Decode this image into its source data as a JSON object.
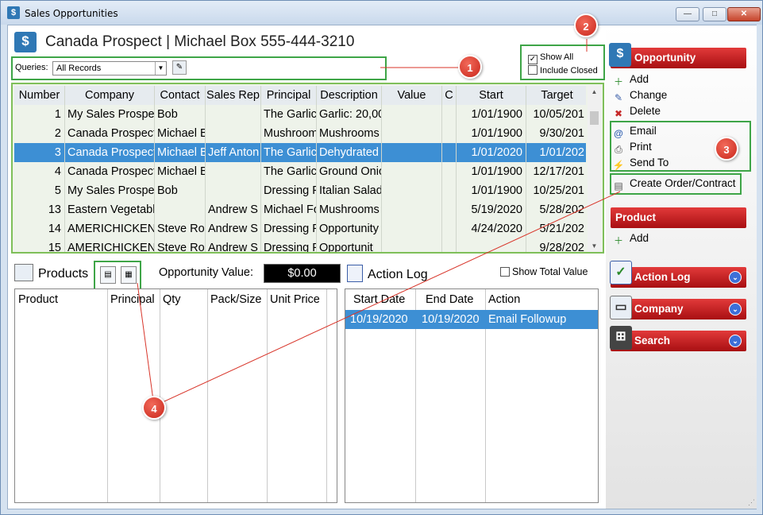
{
  "window": {
    "title": "Sales Opportunities",
    "minimize": "—",
    "maximize": "□",
    "close": "✕"
  },
  "header": {
    "title": "Canada Prospect | Michael Box 555-444-3210"
  },
  "queries": {
    "label": "Queries:",
    "selected": "All Records"
  },
  "filters": {
    "show_all": "Show All",
    "show_all_checked": true,
    "include_closed": "Include Closed",
    "include_closed_checked": false
  },
  "grid": {
    "columns": [
      "Number",
      "Company",
      "Contact",
      "Sales Rep",
      "Principal",
      "Description",
      "Value",
      "C",
      "Start",
      "Target"
    ],
    "rows": [
      [
        "1",
        "My Sales Prospect",
        "Bob",
        "",
        "The Garlic",
        "Garlic: 20,00",
        "",
        "",
        "1/01/1900",
        "10/05/201"
      ],
      [
        "2",
        "Canada Prospect",
        "Michael B",
        "",
        "Mushroom",
        "Mushrooms",
        "",
        "",
        "1/01/1900",
        "9/30/201"
      ],
      [
        "3",
        "Canada Prospect",
        "Michael B",
        "Jeff Anton",
        "The Garlic",
        "Dehydrated",
        "",
        "",
        "1/01/2020",
        "1/01/202"
      ],
      [
        "4",
        "Canada Prospect",
        "Michael B",
        "",
        "The Garlic",
        "Ground Onio",
        "",
        "",
        "1/01/1900",
        "12/17/201"
      ],
      [
        "5",
        "My Sales Prospect",
        "Bob",
        "",
        "Dressing F",
        "Italian Salad",
        "",
        "",
        "1/01/1900",
        "10/25/201"
      ],
      [
        "13",
        "Eastern Vegetable",
        "",
        "Andrew S",
        "Michael Fo",
        "Mushrooms",
        "",
        "",
        "5/19/2020",
        "5/28/202"
      ],
      [
        "14",
        "AMERICHICKEN",
        "Steve Ro",
        "Andrew S",
        "Dressing F",
        "Opportunity",
        "",
        "",
        "4/24/2020",
        "5/21/202"
      ],
      [
        "15",
        "AMERICHICKEN",
        "Steve Ro",
        "Andrew S",
        "Dressing F",
        "Opportunit",
        "",
        "",
        "",
        "9/28/202"
      ]
    ],
    "selected_row": 2
  },
  "products": {
    "label": "Products",
    "columns": [
      "Product",
      "Principal",
      "Qty",
      "Pack/Size",
      "Unit Price"
    ]
  },
  "opportunity_value": {
    "label": "Opportunity Value:",
    "value": "$0.00"
  },
  "action_log": {
    "label": "Action Log",
    "show_total": "Show Total Value",
    "columns": [
      "Start Date",
      "End Date",
      "Action"
    ],
    "rows": [
      [
        "10/19/2020",
        "10/19/2020",
        "Email Followup"
      ]
    ]
  },
  "sidebar": {
    "opportunity": {
      "title": "Opportunity",
      "items": [
        "Add",
        "Change",
        "Delete",
        "Email",
        "Print",
        "Send To",
        "Create Order/Contract"
      ]
    },
    "product": {
      "title": "Product",
      "items": [
        "Add"
      ]
    },
    "action_log": {
      "title": "Action Log"
    },
    "company": {
      "title": "Company"
    },
    "search": {
      "title": "Search"
    }
  },
  "callouts": [
    "1",
    "2",
    "3",
    "4"
  ],
  "colors": {
    "accent_green": "#3ea547",
    "selection_blue": "#3d8fd4",
    "sidebar_red": "#c8181b",
    "callout_red": "#d8352a"
  }
}
